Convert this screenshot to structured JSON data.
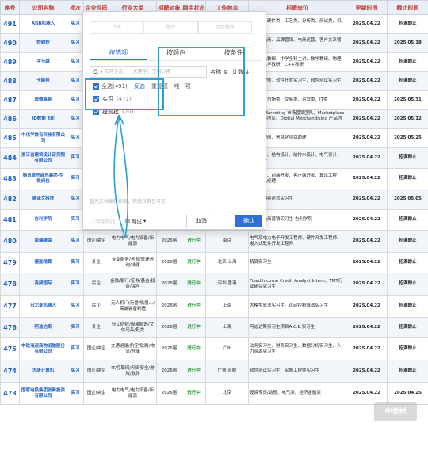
{
  "sheet": {
    "headers": [
      "序号",
      "公司名称",
      "批次",
      "企业性质",
      "行业大类",
      "招聘对象",
      "网申状态",
      "工作地点",
      "招聘岗位",
      "更新时间",
      "截止时间"
    ],
    "rows": [
      {
        "no": "491",
        "company": "ABB机器人",
        "batch": "实习",
        "nature": "",
        "industry": "",
        "target": "",
        "net": "",
        "loc": "上海 北京",
        "pos": "研发类、硬件类、工艺类、分析类、测试类、机械类、",
        "upd": "2025.04.22",
        "dl": "招满即止"
      },
      {
        "no": "490",
        "company": "妙韵妙",
        "batch": "实习",
        "nature": "",
        "industry": "",
        "target": "",
        "net": "",
        "loc": "上海 北京 成都",
        "pos": "数字与电商、品牌营销、电商运营、客户关系管理、销售",
        "upd": "2025.04.22",
        "dl": "2025.05.18"
      },
      {
        "no": "489",
        "company": "字节跳",
        "batch": "实习",
        "nature": "",
        "industry": "",
        "target": "",
        "net": "",
        "loc": "北京 上海 广州 深圳 杭州",
        "pos": "小学算法教研、中学全科主讲、数学教研、物理教研、化学教研、C++教研",
        "upd": "2025.04.22",
        "dl": "招满即止"
      },
      {
        "no": "488",
        "company": "卡斯柯",
        "batch": "实习",
        "nature": "",
        "industry": "",
        "target": "",
        "net": "",
        "loc": "上海",
        "pos": "研发工程师、软件开发实习生、软件测试实习生",
        "upd": "2025.04.22",
        "dl": "招满即止"
      },
      {
        "no": "487",
        "company": "翠微基金",
        "batch": "实习",
        "nature": "",
        "industry": "",
        "target": "",
        "net": "",
        "loc": "上海 深圳",
        "pos": "投研类、市场类、交易类、运营类、IT类",
        "upd": "2025.04.22",
        "dl": "2025.05.31"
      },
      {
        "no": "486",
        "company": "JD数据飞轮",
        "batch": "实习",
        "nature": "",
        "industry": "",
        "target": "",
        "net": "",
        "loc": "中国总部(上海)",
        "pos": "Brand Marketing 市场营销团队、Marketplace 市场发展团队、Digital Merchandising 产品团队",
        "upd": "2025.04.22",
        "dl": "2025.05.12"
      },
      {
        "no": "485",
        "company": "中化学校有科技有限公司",
        "batch": "实习",
        "nature": "",
        "industry": "",
        "target": "",
        "net": "",
        "loc": "北京",
        "pos": "综合管理岗、信息化项目助理",
        "upd": "2025.04.22",
        "dl": "2025.05.25"
      },
      {
        "no": "484",
        "company": "浙江省建筑设计研究院有限公司",
        "batch": "实习",
        "nature": "",
        "industry": "",
        "target": "",
        "net": "",
        "loc": "杭州",
        "pos": "建筑设计、结构设计、给排水设计、电气设计、景观设计",
        "upd": "2025.04.22",
        "dl": "招满即止"
      },
      {
        "no": "483",
        "company": "腾讯音乐娱乐集团-空铁岗位",
        "batch": "实习",
        "nature": "",
        "industry": "",
        "target": "",
        "net": "",
        "loc": "深圳 北京 上海",
        "pos": "后台开发、前端开发、客户端开发、算法工程师、产品经理",
        "upd": "2025.04.22",
        "dl": "招满即止"
      },
      {
        "no": "482",
        "company": "德泽文科技",
        "batch": "实习",
        "nature": "",
        "industry": "",
        "target": "",
        "net": "",
        "loc": "重庆",
        "pos": "新媒体内容运营实习生",
        "upd": "2025.04.22",
        "dl": "2025.05.05"
      },
      {
        "no": "481",
        "company": "吉利学院",
        "batch": "实习",
        "nature": "民企",
        "industry": "汽车制造/汽车零部件/汽车用品/汽车服务",
        "target": "2026届",
        "net": "进行中",
        "loc": "全国",
        "pos": "信息流电商营销实习生-吉利学院",
        "upd": "2025.04.22",
        "dl": "招满即止"
      },
      {
        "no": "480",
        "company": "南瑞继保",
        "batch": "实习",
        "nature": "国企/央企",
        "industry": "电力电气/电力设备/新能源",
        "target": "2026届",
        "net": "进行中",
        "loc": "南京",
        "pos": "电气及电力电子开发工程师、硬件开发工程师、嵌入式软件开发工程师",
        "upd": "2025.04.22",
        "dl": "招满即止"
      },
      {
        "no": "479",
        "company": "德勤精算",
        "batch": "实习",
        "nature": "外企",
        "industry": "专业服务/咨询/管理咨询/法律",
        "target": "2026届",
        "net": "进行中",
        "loc": "北京 上海",
        "pos": "精算实习生",
        "upd": "2025.04.22",
        "dl": "招满即止"
      },
      {
        "no": "478",
        "company": "高频国际",
        "batch": "实习",
        "nature": "民企",
        "industry": "金融/银行/证券/基金/投资/保险",
        "target": "2026届",
        "net": "进行中",
        "loc": "深圳 香港",
        "pos": "Fixed Income Credit Analyst Intern、TMT行业研究实习生",
        "upd": "2025.04.22",
        "dl": "招满即止"
      },
      {
        "no": "477",
        "company": "日北麦机器人",
        "batch": "实习",
        "nature": "民企",
        "industry": "无人机/飞行器/机器人/高端装备制造",
        "target": "2026届",
        "net": "进行中",
        "loc": "上海",
        "pos": "大模型算法实习生、运动控制算法实习生",
        "upd": "2025.04.22",
        "dl": "招满即止"
      },
      {
        "no": "476",
        "company": "阿迪达斯",
        "batch": "实习",
        "nature": "外企",
        "industry": "轻工纺织/服装服饰/文体用品/鞋类",
        "target": "2026届",
        "net": "进行中",
        "loc": "上海",
        "pos": "阿迪达斯实习生项目A.C.E.实习生",
        "upd": "2025.04.22",
        "dl": "招满即止"
      },
      {
        "no": "475",
        "company": "中铁海运商物运输股份有限公司",
        "batch": "实习",
        "nature": "国企/央企",
        "industry": "交通运输/航空/铁路/物流/仓储",
        "target": "2026届",
        "net": "进行中",
        "loc": "广州",
        "pos": "法务实习生、财务实习生、数据分析实习生、人力资源实习生",
        "upd": "2025.04.22",
        "dl": "招满即止"
      },
      {
        "no": "474",
        "company": "大唐计算机",
        "batch": "实习",
        "nature": "国企/央企",
        "industry": "IT/互联网/网络安全/游戏/软件",
        "target": "2026届",
        "net": "进行中",
        "loc": "广州 合肥",
        "pos": "软件测试实习生、实施工程师实习生",
        "upd": "2025.04.22",
        "dl": "招满即止"
      },
      {
        "no": "473",
        "company": "国家电投集团创新投资有限公司",
        "batch": "实习",
        "nature": "国企/央企",
        "industry": "电力电气/电力设备/新能源",
        "target": "2026届",
        "net": "进行中",
        "loc": "北京",
        "pos": "投资专员/助理、电气类、经济金融类",
        "upd": "2025.04.22",
        "dl": "2025.04.25"
      }
    ]
  },
  "popup": {
    "sort_tabs": [
      "升序",
      "降序",
      "颜色排序"
    ],
    "tabs": [
      "按选项",
      "按颜色",
      "按条件"
    ],
    "search_placeholder": "支持多选一一关键字，空格分隔",
    "sort_name": "名称",
    "count_label": "计数",
    "select_all": "全选(491)",
    "invert": "反选",
    "duplicate": "重复项",
    "unique": "唯一项",
    "items": [
      {
        "label": "实习",
        "count": "(471)"
      },
      {
        "label": "提前批",
        "count": "(20)"
      }
    ],
    "hint": "暂无文档编辑权限，筛选仅自己可见",
    "clear": "清除筛选",
    "export": "导出",
    "cancel": "取消",
    "ok": "确认"
  },
  "watermark": "中关村",
  "accent": "#2f6fd6",
  "annotation_color": "#2a9fd6"
}
